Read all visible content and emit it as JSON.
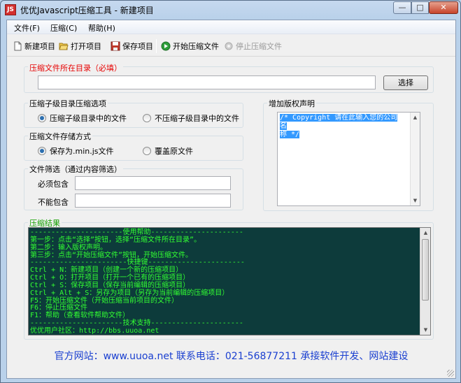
{
  "window": {
    "title": "优优Javascript压缩工具 - 新建项目",
    "icon": "app-logo-icon",
    "controls": {
      "minimize": "—",
      "maximize": "□",
      "close": "✕"
    }
  },
  "menu": [
    "文件(F)",
    "压缩(C)",
    "帮助(H)"
  ],
  "toolbar": {
    "new_project": "新建项目",
    "open_project": "打开项目",
    "save_project": "保存项目",
    "start_compress": "开始压缩文件",
    "stop_compress": "停止压缩文件"
  },
  "directory": {
    "title": "压缩文件所在目录（必填）",
    "value": "",
    "browse_button": "选择"
  },
  "subdir_options": {
    "title": "压缩子级目录压缩选项",
    "option1": "压缩子级目录中的文件",
    "option2": "不压缩子级目录中的文件",
    "selected": 1
  },
  "save_mode": {
    "title": "压缩文件存储方式",
    "option1": "保存为.min.js文件",
    "option2": "覆盖原文件",
    "selected": 1
  },
  "filter": {
    "title": "文件筛选（通过内容筛选）",
    "must_contain_label": "必须包含",
    "must_contain_value": "",
    "not_contain_label": "不能包含",
    "not_contain_value": ""
  },
  "copyright": {
    "title": "增加版权声明",
    "text_line1": "/* Copyright 请在此输入您的公司名",
    "text_line2": "称 */"
  },
  "result": {
    "title": "压缩结果",
    "lines": [
      "----------------------使用帮助----------------------",
      "第一步：点击“选择”按钮，选择“压缩文件所在目录”。",
      "第二步：输入版权声明。",
      "第三步：点击“开始压缩文件”按钮，开始压缩文件。",
      "-----------------------快捷键-----------------------",
      "Ctrl + N：新建项目（创建一个新的压缩项目）",
      "Ctrl + O：打开项目（打开一个已有的压缩项目）",
      "Ctrl + S：保存项目（保存当前编辑的压缩项目）",
      "Ctrl + Alt + S：另存为项目（另存为当前编辑的压缩项目）",
      "F5：开始压缩文件（开始压缩当前项目的文件）",
      "F6：停止压缩文件",
      "F1：帮助（查看软件帮助文件）",
      "----------------------技术支持----------------------",
      "优优用户社区：http://bbs.uuoa.net"
    ]
  },
  "footer": "官方网站：www.uuoa.net 联系电话：021-56877211 承接软件开发、网站建设",
  "colors": {
    "required_label": "#e60000",
    "result_label": "#14a000",
    "console_bg": "#0d3b3b",
    "console_text": "#32ff32",
    "footer_text": "#1a3fd0",
    "selection": "#3399ff"
  }
}
